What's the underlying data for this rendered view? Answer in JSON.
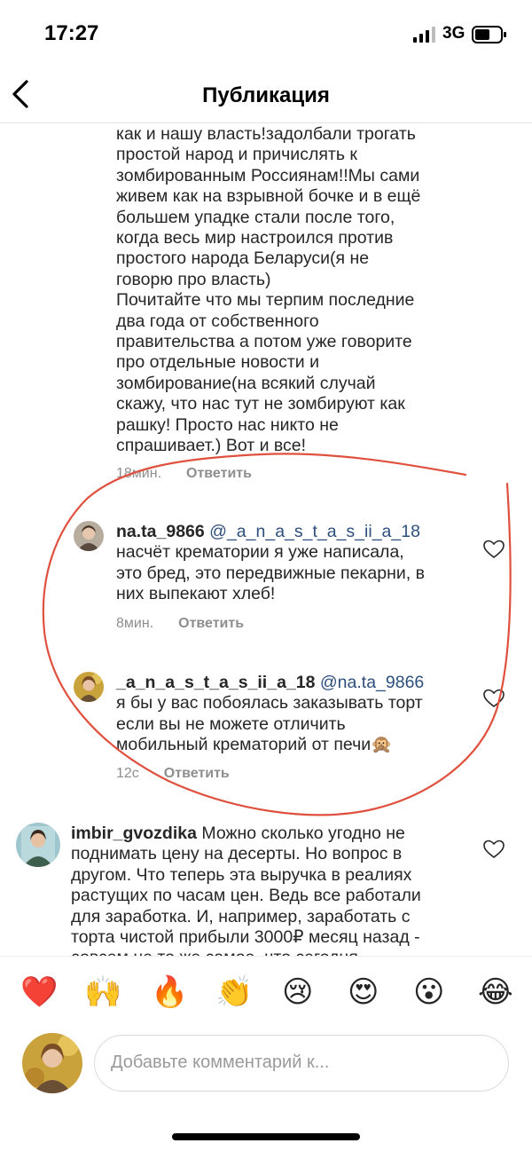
{
  "status_bar": {
    "time": "17:27",
    "network": "3G"
  },
  "nav": {
    "title": "Публикация"
  },
  "comments": [
    {
      "text_lines": [
        "как и нашу власть!задолбали трогать",
        "простой народ и причислять к",
        "зомбированным Россиянам!!Мы сами",
        "живем как на взрывной бочке и в ещё",
        "большем упадке стали после того,",
        "когда весь мир настроился против",
        "простого народа Беларуси(я не",
        "говорю про власть)",
        "Почитайте что мы терпим последние",
        "два года от собственного",
        "правительства а потом уже говорите",
        "про отдельные новости и",
        "зомбирование(на всякий случай",
        "скажу, что нас тут не зомбируют как",
        "рашку! Просто нас никто не",
        "спрашивает.) Вот и все!"
      ],
      "time": "18мин.",
      "reply_label": "Ответить"
    },
    {
      "username": "na.ta_9866",
      "mention": "@_a_n_a_s_t_a_s_ii_a_18",
      "text_lines": [
        "насчёт крематории я уже написала,",
        "это бред, это передвижные пекарни, в",
        "них выпекают хлеб!"
      ],
      "time": "8мин.",
      "reply_label": "Ответить"
    },
    {
      "username": "_a_n_a_s_t_a_s_ii_a_18",
      "mention": "@na.ta_9866",
      "text_lines": [
        "я бы у вас побоялась заказывать торт",
        "если вы не можете отличить",
        "мобильный крематорий от печи🙊"
      ],
      "time": "12с",
      "reply_label": "Ответить"
    },
    {
      "username": "imbir_gvozdika",
      "text_first": "Можно сколько угодно не",
      "text_lines": [
        "поднимать цену на десерты. Но вопрос в",
        "другом. Что теперь эта выручка в реалиях",
        "растущих по часам цен. Ведь все работали",
        "для заработка. И, например, заработать с",
        "торта чистой прибыли 3000₽ месяц назад -",
        "совсем не то же самое, что сегодня"
      ]
    }
  ],
  "reactions": [
    "❤️",
    "🙌",
    "🔥",
    "👏",
    "😢",
    "😍",
    "😮",
    "😂"
  ],
  "composer": {
    "placeholder": "Добавьте комментарий к..."
  },
  "colors": {
    "mention": "#2d4f7c",
    "annotation": "#e0503e",
    "meta": "#8e8e8e"
  }
}
